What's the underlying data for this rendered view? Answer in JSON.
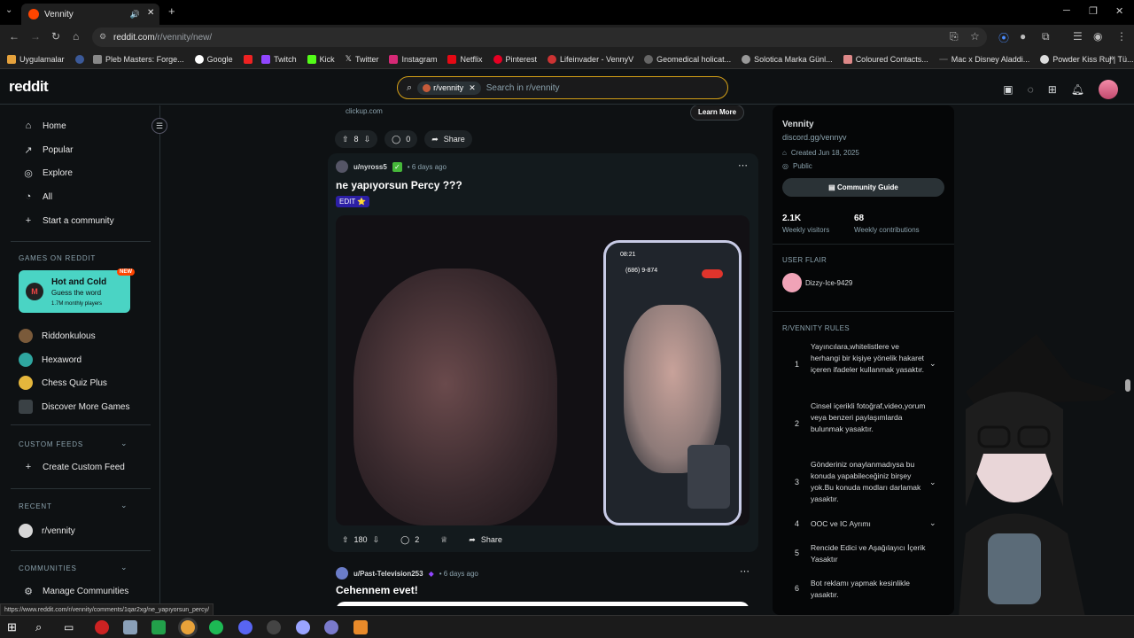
{
  "browser": {
    "tab_title": "Vennity",
    "url_host": "reddit.com",
    "url_path": "/r/vennity/new/",
    "status_url": "https://www.reddit.com/r/vennity/comments/1qar2xg/ne_yapıyorsun_percy/",
    "bookmarks": [
      "Uygulamalar",
      "Pleb Masters: Forge...",
      "Google",
      "Twitch",
      "Kick",
      "Twitter",
      "Instagram",
      "Netflix",
      "Pinterest",
      "Lifeinvader - VennyV",
      "Geomedical holicat...",
      "Solotica Marka Günl...",
      "Coloured Contacts...",
      "Mac x Disney Aladdi...",
      "Powder Kiss Ruj | Tü..."
    ]
  },
  "header": {
    "logo": "reddit",
    "search_chip": "r/vennity",
    "search_placeholder": "Search in r/vennity"
  },
  "leftnav": {
    "items": [
      "Home",
      "Popular",
      "Explore",
      "All",
      "Start a community"
    ],
    "games_heading": "GAMES ON REDDIT",
    "featured_game": {
      "title": "Hot and Cold",
      "subtitle": "Guess the word",
      "players": "1.7M monthly players",
      "badge": "NEW",
      "icon_text": "M"
    },
    "games": [
      "Riddonkulous",
      "Hexaword",
      "Chess Quiz Plus",
      "Discover More Games"
    ],
    "custom_feeds_heading": "CUSTOM FEEDS",
    "create_feed": "Create Custom Feed",
    "recent_heading": "RECENT",
    "recent_item": "r/vennity",
    "communities_heading": "COMMUNITIES",
    "manage": "Manage Communities"
  },
  "feed": {
    "ad_domain": "clickup.com",
    "learn_more": "Learn More",
    "prev_votes": "8",
    "prev_comments": "0",
    "share": "Share",
    "post": {
      "author": "u/nyross5",
      "time": "• 6 days ago",
      "title": "ne yapıyorsun Percy ???",
      "flair": "EDIT ⭐",
      "votes": "180",
      "comments": "2",
      "phone_time": "08:21",
      "phone_number": "(686) 9-874"
    },
    "next_post": {
      "author": "u/Past-Television253",
      "time": "• 6 days ago",
      "title": "Cehennem evet!"
    }
  },
  "sidebar": {
    "name": "Vennity",
    "link": "discord.gg/vennyv",
    "created": "Created Jun 18, 2025",
    "visibility": "Public",
    "guide_button": "Community Guide",
    "visitors": "2.1K",
    "visitors_label": "Weekly visitors",
    "contributions": "68",
    "contributions_label": "Weekly contributions",
    "flair_heading": "USER FLAIR",
    "flair_user": "Dizzy-Ice-9429",
    "rules_heading": "R/VENNITY RULES",
    "rules": [
      {
        "n": "1",
        "text": "Yayıncılara,whitelistlere ve herhangi bir kişiye yönelik hakaret içeren ifadeler kullanmak yasaktır."
      },
      {
        "n": "2",
        "text": "Cinsel içerikli fotoğraf,video,yorum veya benzeri paylaşımlarda bulunmak yasaktır."
      },
      {
        "n": "3",
        "text": "Gönderiniz onaylanmadıysa bu konuda yapabileceğiniz birşey yok.Bu konuda modları darlamak yasaktır."
      },
      {
        "n": "4",
        "text": "OOC ve IC Ayrımı"
      },
      {
        "n": "5",
        "text": "Rencide Edici ve Aşağılayıcı İçerik Yasaktır"
      },
      {
        "n": "6",
        "text": "Bot reklamı yapmak kesinlikle yasaktır."
      }
    ]
  },
  "colors": {
    "accent": "#ff4500",
    "bg": "#0e1113",
    "search_border": "#d4a017"
  }
}
